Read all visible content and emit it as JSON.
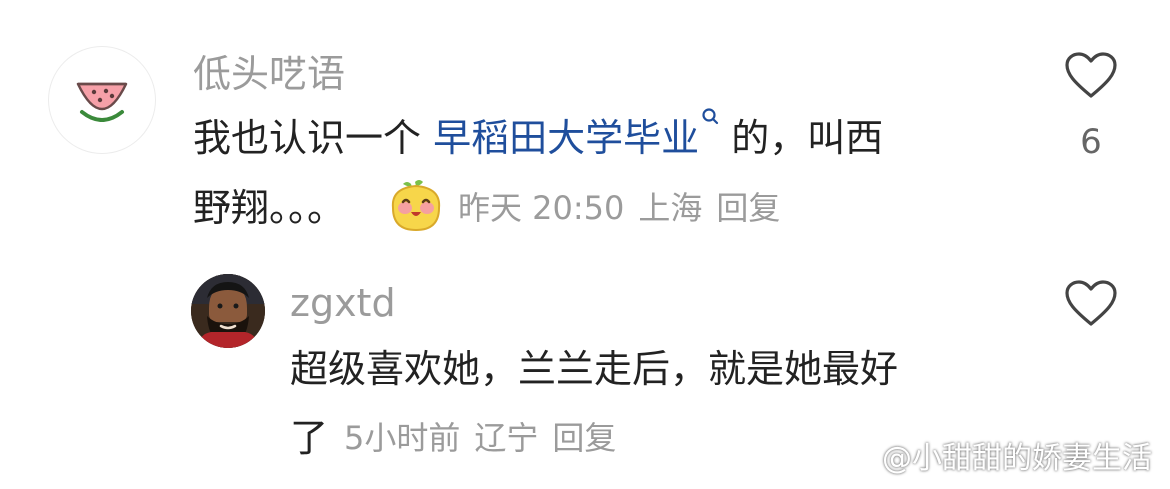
{
  "comments": [
    {
      "username": "低头呓语",
      "text_before": "我也认识一个 ",
      "link_text": "早稻田大学毕业",
      "text_after": " 的，叫西",
      "text_line2": "野翔。。。",
      "emoji_name": "happy-face-emoji",
      "time": "昨天 20:50",
      "location": "上海",
      "reply_label": "回复",
      "like_count": "6",
      "avatar_icon": "watermelon-icon"
    },
    {
      "username": "zgxtd",
      "text_line1": "超级喜欢她，兰兰走后，就是她最好",
      "text_line2": "了",
      "time": "5小时前",
      "location": "辽宁",
      "reply_label": "回复",
      "like_count": "",
      "avatar_icon": "bearded-man-avatar"
    }
  ],
  "watermark": {
    "text": "@小甜甜的娇妻生活"
  },
  "colors": {
    "username": "#9b9b9b",
    "body": "#222222",
    "link": "#1f4e9c",
    "meta": "#9b9b9b"
  }
}
